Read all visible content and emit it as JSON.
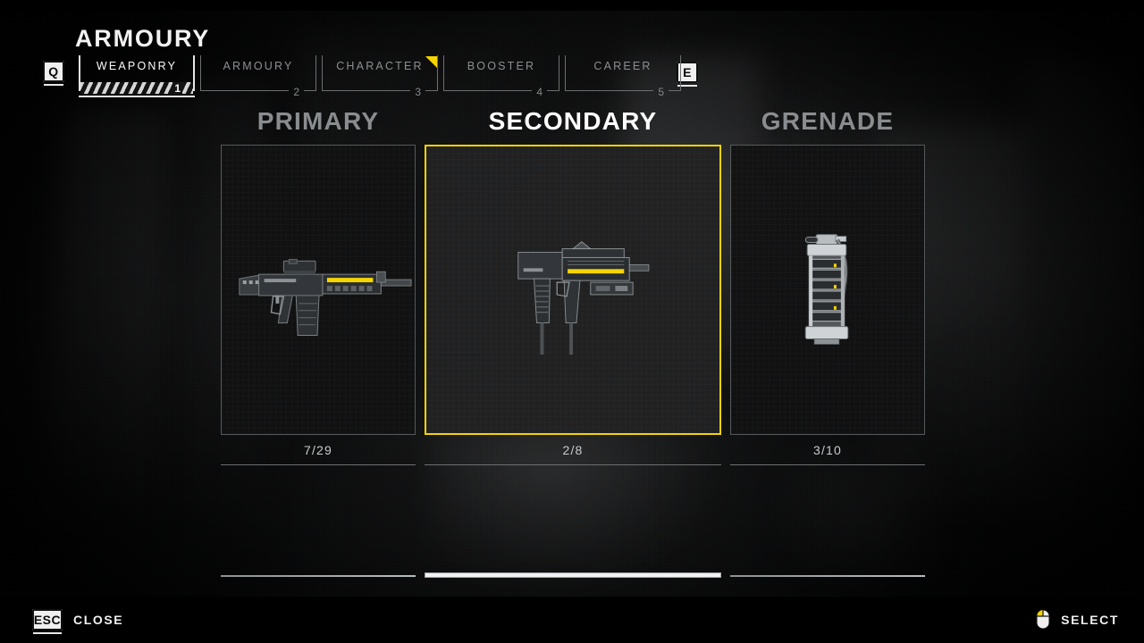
{
  "header": {
    "title": "ARMOURY",
    "prev_key": "Q",
    "next_key": "E"
  },
  "tabs": [
    {
      "label": "WEAPONRY",
      "index": "1",
      "active": true,
      "flag": false
    },
    {
      "label": "ARMOURY",
      "index": "2",
      "active": false,
      "flag": false
    },
    {
      "label": "CHARACTER",
      "index": "3",
      "active": false,
      "flag": true
    },
    {
      "label": "BOOSTER",
      "index": "4",
      "active": false,
      "flag": false
    },
    {
      "label": "CAREER",
      "index": "5",
      "active": false,
      "flag": false
    }
  ],
  "categories": [
    {
      "title": "PRIMARY",
      "count": "7/29",
      "selected": false,
      "item_icon": "assault-rifle-icon"
    },
    {
      "title": "SECONDARY",
      "count": "2/8",
      "selected": true,
      "item_icon": "submachine-gun-icon"
    },
    {
      "title": "GRENADE",
      "count": "3/10",
      "selected": false,
      "item_icon": "grenade-icon"
    }
  ],
  "hints": {
    "close": {
      "key": "ESC",
      "label": "CLOSE",
      "icon": "esc-key-icon"
    },
    "select": {
      "label": "SELECT",
      "icon": "mouse-left-click-icon"
    }
  },
  "colors": {
    "accent": "#f5d400",
    "selected_text": "#ffffff",
    "muted_text": "#8a8d8f",
    "panel_bg": "#111112",
    "border": "#55585a"
  }
}
